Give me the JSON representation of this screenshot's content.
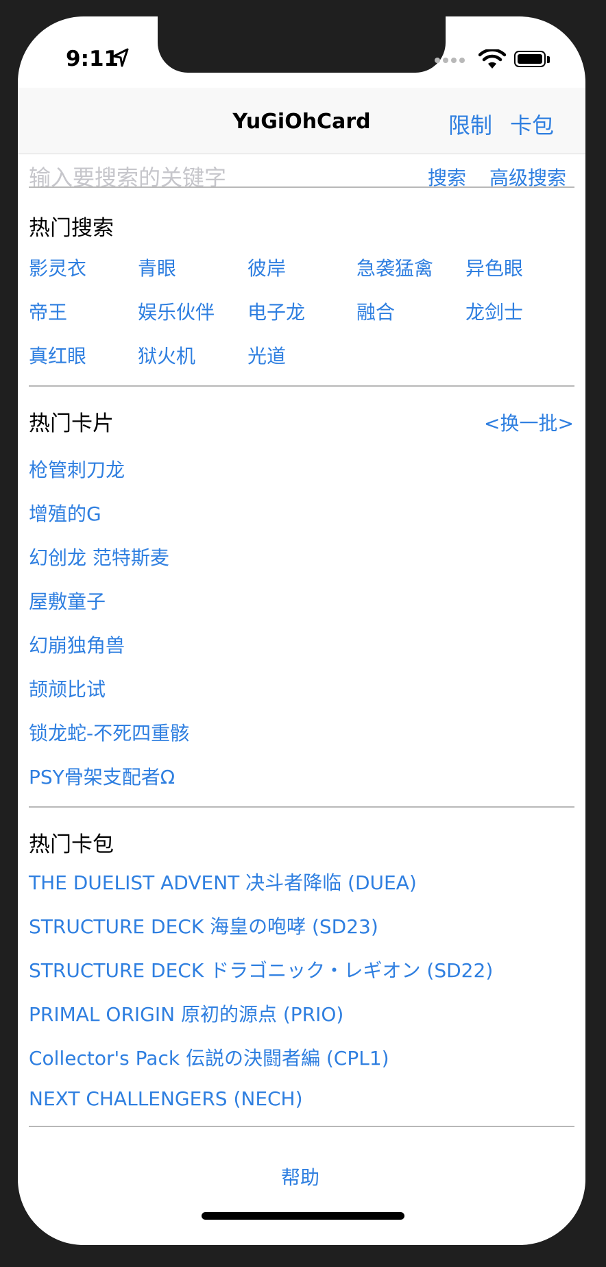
{
  "status": {
    "time": "9:11"
  },
  "nav": {
    "title": "YuGiOhCard",
    "right_buttons": [
      "限制",
      "卡包"
    ]
  },
  "search": {
    "placeholder": "输入要搜索的关键字",
    "search_label": "搜索",
    "advanced_label": "高级搜索"
  },
  "hot_search": {
    "title": "热门搜索",
    "items": [
      "影灵衣",
      "青眼",
      "彼岸",
      "急袭猛禽",
      "异色眼",
      "帝王",
      "娱乐伙伴",
      "电子龙",
      "融合",
      "龙剑士",
      "真红眼",
      "狱火机",
      "光道"
    ]
  },
  "hot_cards": {
    "title": "热门卡片",
    "refresh_label": "<换一批>",
    "items": [
      "枪管刺刀龙",
      "增殖的G",
      "幻创龙 范特斯麦",
      "屋敷童子",
      "幻崩独角兽",
      "颉颃比试",
      "锁龙蛇-不死四重骸",
      "PSY骨架支配者Ω"
    ]
  },
  "hot_packs": {
    "title": "热门卡包",
    "items": [
      "THE DUELIST ADVENT 决斗者降临 (DUEA)",
      "STRUCTURE DECK 海皇の咆哮 (SD23)",
      "STRUCTURE DECK ドラゴニック・レギオン (SD22)",
      "PRIMAL ORIGIN 原初的源点 (PRIO)",
      "Collector's Pack 伝説の決闘者編 (CPL1)",
      "NEXT CHALLENGERS (NECH)"
    ]
  },
  "footer": {
    "help_label": "帮助"
  }
}
